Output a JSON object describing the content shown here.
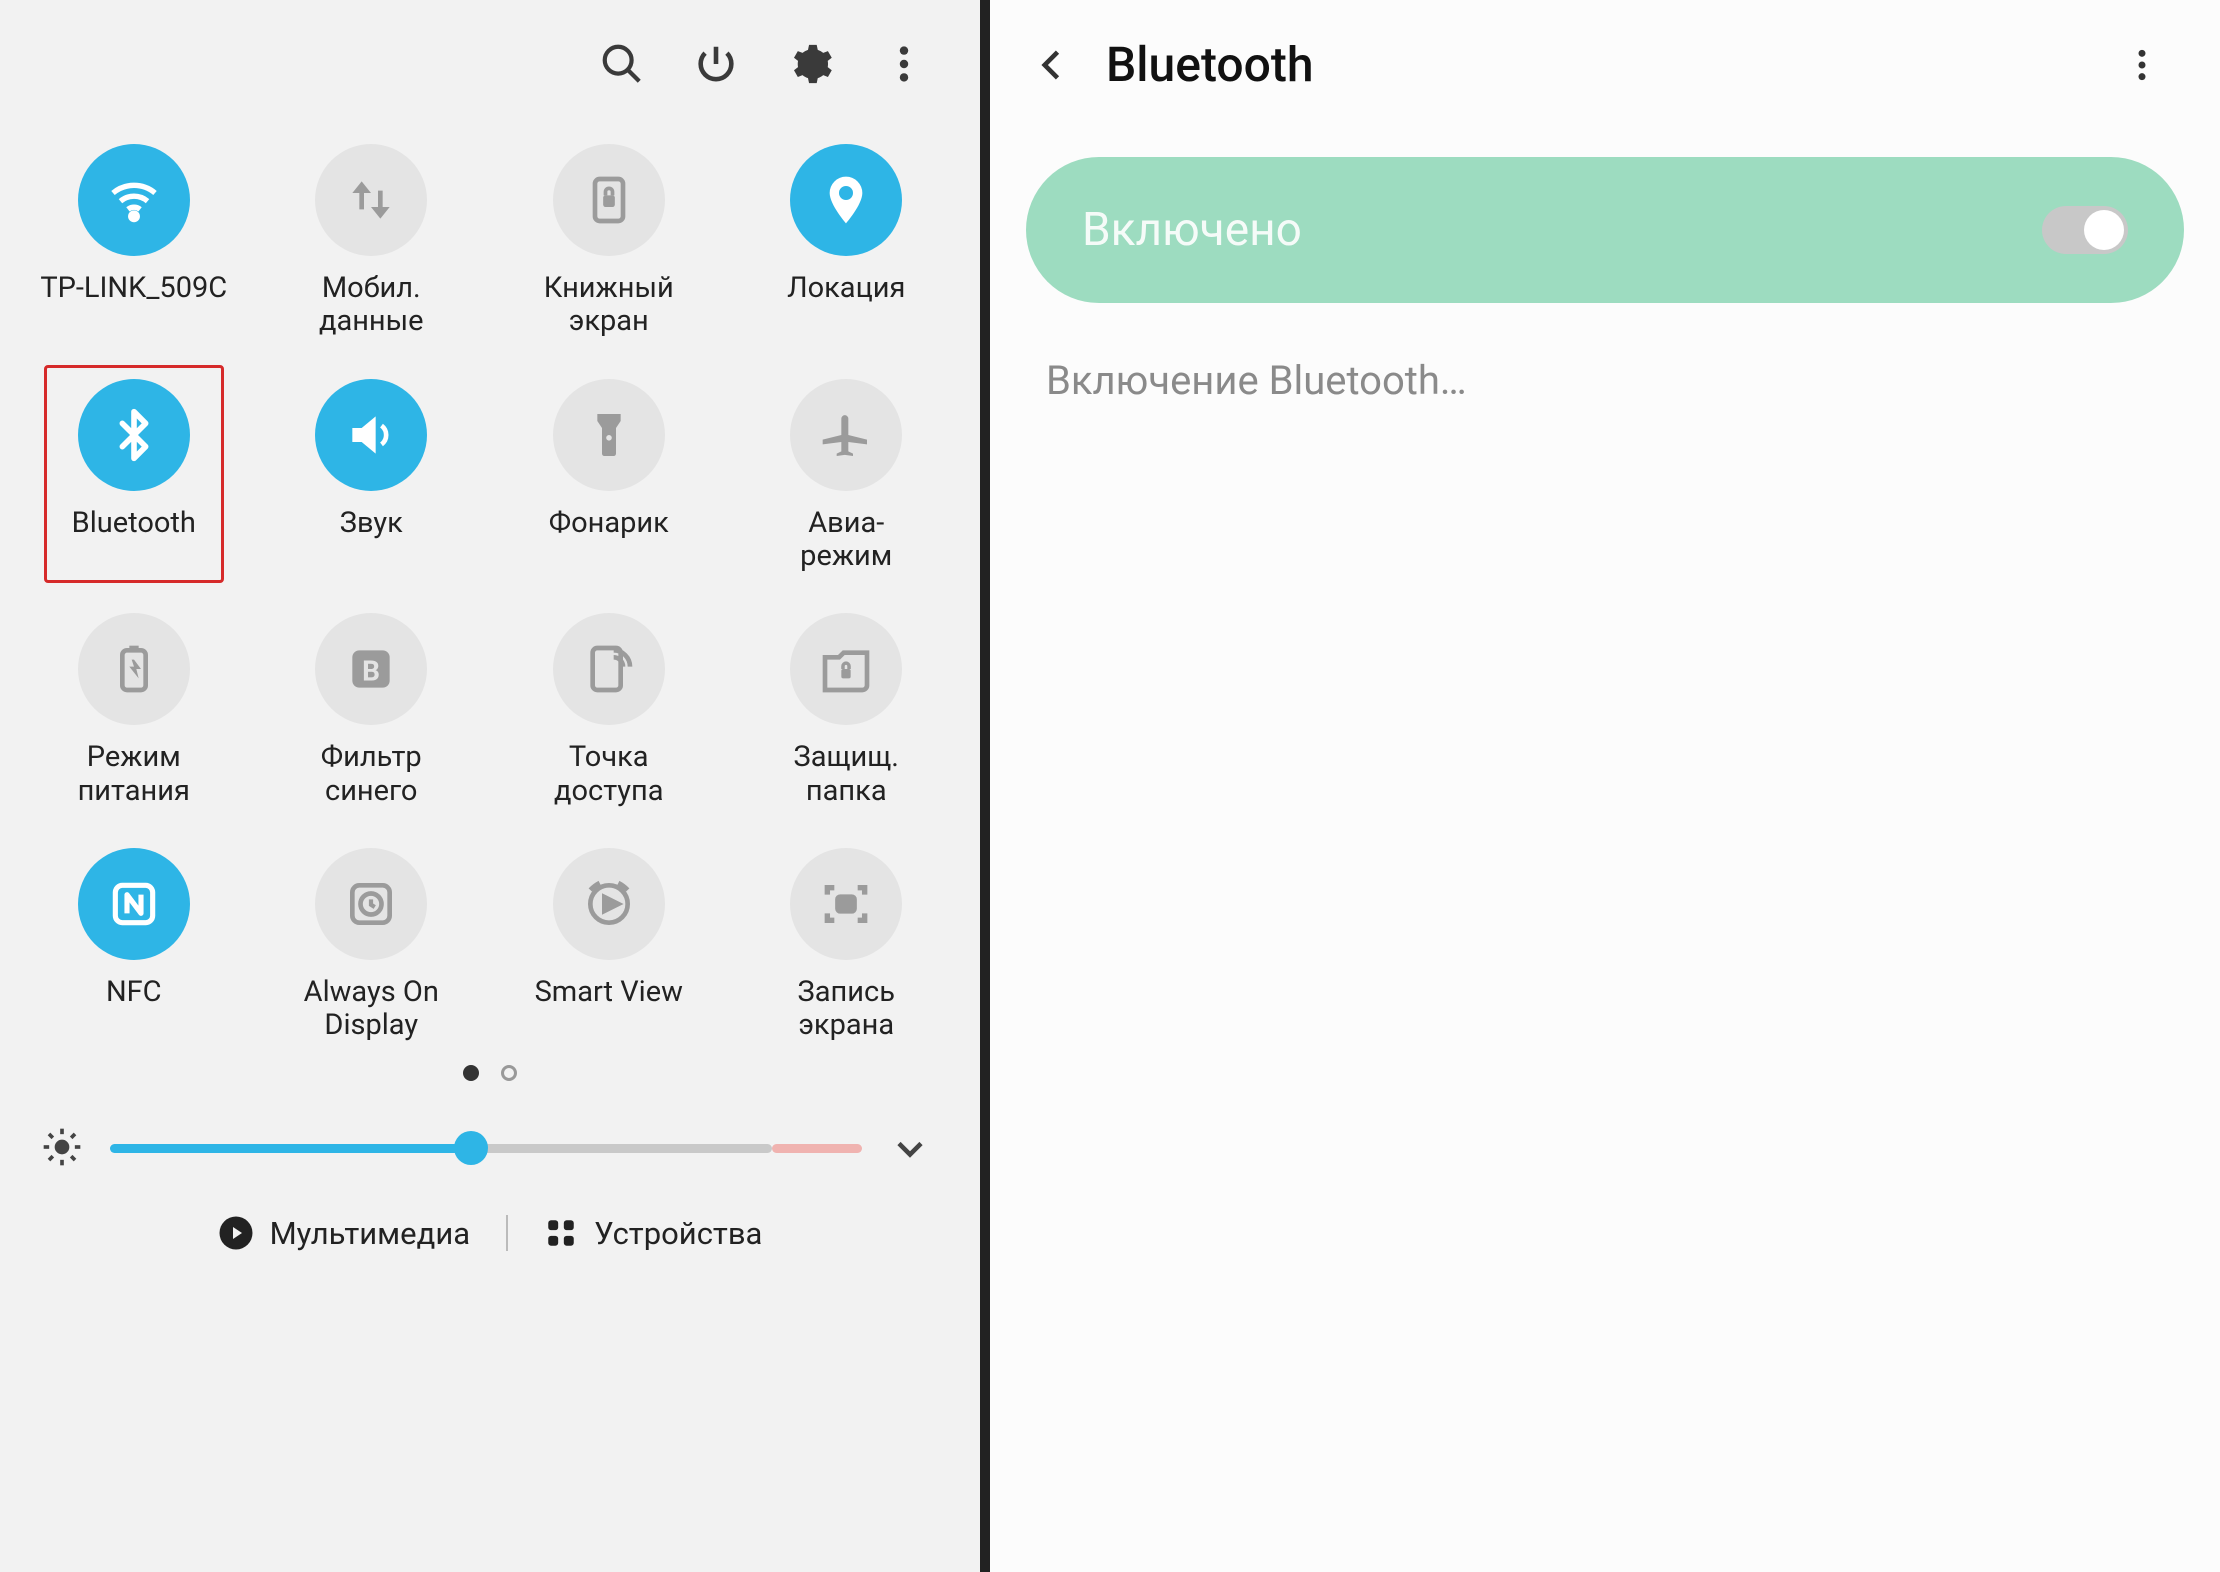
{
  "left": {
    "tiles": [
      {
        "id": "wifi",
        "label": "TP-LINK_509C",
        "active": true,
        "icon": "wifi"
      },
      {
        "id": "mobiledata",
        "label": "Мобил.\nданные",
        "active": false,
        "icon": "updown"
      },
      {
        "id": "ebook",
        "label": "Книжный\nэкран",
        "active": false,
        "icon": "booklock"
      },
      {
        "id": "location",
        "label": "Локация",
        "active": true,
        "icon": "pin"
      },
      {
        "id": "bluetooth",
        "label": "Bluetooth",
        "active": true,
        "icon": "bluetooth",
        "highlight": true
      },
      {
        "id": "sound",
        "label": "Звук",
        "active": true,
        "icon": "speaker"
      },
      {
        "id": "flashlight",
        "label": "Фонарик",
        "active": false,
        "icon": "flashlight"
      },
      {
        "id": "airplane",
        "label": "Авиа-\nрежим",
        "active": false,
        "icon": "airplane"
      },
      {
        "id": "powermode",
        "label": "Режим\nпитания",
        "active": false,
        "icon": "batteryrec"
      },
      {
        "id": "bluefilter",
        "label": "Фильтр\nсинего",
        "active": false,
        "icon": "letterB"
      },
      {
        "id": "hotspot",
        "label": "Точка\nдоступа",
        "active": false,
        "icon": "hotspot"
      },
      {
        "id": "secfolder",
        "label": "Защищ.\nпапка",
        "active": false,
        "icon": "securefolder"
      },
      {
        "id": "nfc",
        "label": "NFC",
        "active": true,
        "icon": "nfc"
      },
      {
        "id": "aod",
        "label": "Always On\nDisplay",
        "active": false,
        "icon": "clockrect"
      },
      {
        "id": "smartview",
        "label": "Smart View",
        "active": false,
        "icon": "cast"
      },
      {
        "id": "screenrec",
        "label": "Запись\nэкрана",
        "active": false,
        "icon": "capture"
      }
    ],
    "pager": {
      "current": 0,
      "total": 2
    },
    "brightness": {
      "value": 48,
      "max": 100
    },
    "bottom": {
      "media": "Мультимедиа",
      "devices": "Устройства"
    }
  },
  "right": {
    "title": "Bluetooth",
    "pill_label": "Включено",
    "toggle_on": true,
    "status": "Включение Bluetooth…"
  }
}
